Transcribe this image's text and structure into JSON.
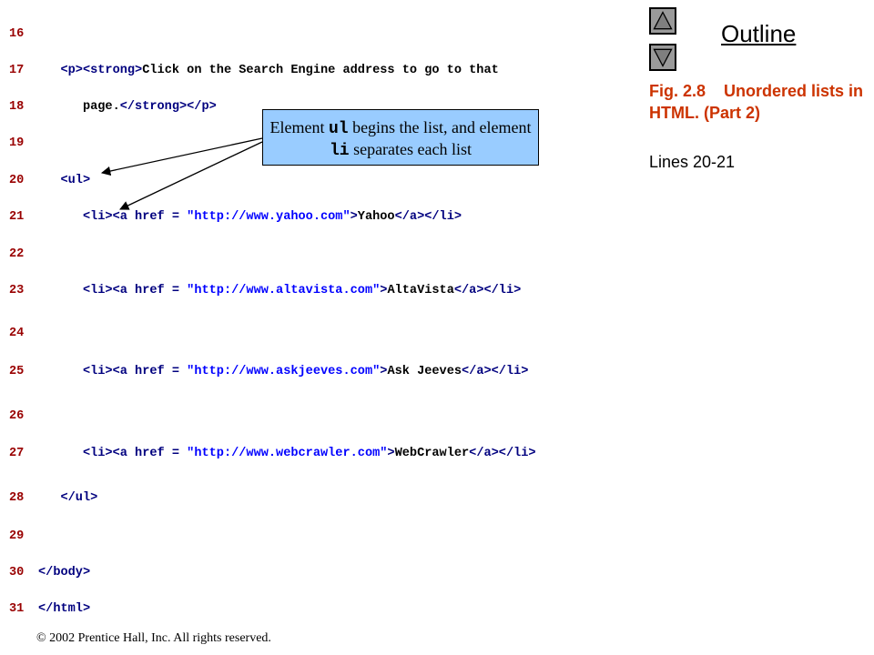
{
  "code": {
    "lines": [
      {
        "num": "16",
        "segments": []
      },
      {
        "num": "17",
        "segments": [
          {
            "t": "tag",
            "s": "   <p><strong>"
          },
          {
            "t": "txt",
            "s": "Click on the Search Engine address to go to that"
          }
        ]
      },
      {
        "num": "18",
        "segments": [
          {
            "t": "txt",
            "s": "      page."
          },
          {
            "t": "tag",
            "s": "</strong></p>"
          }
        ]
      },
      {
        "num": "19",
        "segments": []
      },
      {
        "num": "20",
        "segments": [
          {
            "t": "tag",
            "s": "   <ul>"
          }
        ]
      },
      {
        "num": "21",
        "segments": [
          {
            "t": "tag",
            "s": "      <li><a href = "
          },
          {
            "t": "str",
            "s": "\"http://www.yahoo.com\""
          },
          {
            "t": "tag",
            "s": ">"
          },
          {
            "t": "txt",
            "s": "Yahoo"
          },
          {
            "t": "tag",
            "s": "</a></li>"
          }
        ]
      },
      {
        "num": "22",
        "segments": []
      },
      {
        "num": "23",
        "segments": [
          {
            "t": "tag",
            "s": "      <li><a href = "
          },
          {
            "t": "str",
            "s": "\"http://www.altavista.com\""
          },
          {
            "t": "tag",
            "s": ">"
          },
          {
            "t": "txt",
            "s": "AltaVista"
          },
          {
            "t": "tag",
            "s": "</a></li>"
          }
        ]
      },
      {
        "num": "24",
        "segments": []
      },
      {
        "num": "25",
        "segments": [
          {
            "t": "tag",
            "s": "      <li><a href = "
          },
          {
            "t": "str",
            "s": "\"http://www.askjeeves.com\""
          },
          {
            "t": "tag",
            "s": ">"
          },
          {
            "t": "txt",
            "s": "Ask Jeeves"
          },
          {
            "t": "tag",
            "s": "</a></li>"
          }
        ]
      },
      {
        "num": "26",
        "segments": []
      },
      {
        "num": "27",
        "segments": [
          {
            "t": "tag",
            "s": "      <li><a href = "
          },
          {
            "t": "str",
            "s": "\"http://www.webcrawler.com\""
          },
          {
            "t": "tag",
            "s": ">"
          },
          {
            "t": "txt",
            "s": "WebCrawler"
          },
          {
            "t": "tag",
            "s": "</a></li>"
          }
        ]
      },
      {
        "num": "28",
        "segments": [
          {
            "t": "tag",
            "s": "   </ul>"
          }
        ]
      },
      {
        "num": "29",
        "segments": []
      },
      {
        "num": "30",
        "segments": [
          {
            "t": "tag",
            "s": "</body>"
          }
        ]
      },
      {
        "num": "31",
        "segments": [
          {
            "t": "tag",
            "s": "</html>"
          }
        ]
      }
    ]
  },
  "callout": {
    "text_1": "Element ",
    "code_1": "ul",
    "text_2": " begins the list, and element ",
    "code_2": "li",
    "text_3": " separates each list"
  },
  "sidebar": {
    "title": "Outline",
    "caption": "Fig. 2.8    Unordered lists in HTML. (Part 2)",
    "lines_ref": "Lines 20-21",
    "up_icon": "triangle-up-icon",
    "down_icon": "triangle-down-icon"
  },
  "footer": {
    "copyright": "© 2002 Prentice Hall, Inc.  All rights reserved."
  },
  "colors": {
    "line_number": "#990000",
    "tag": "#00007f",
    "string": "#0000ff",
    "caption": "#cc3300",
    "callout_bg": "#99ccff",
    "button_bg": "#9a9a9a"
  }
}
